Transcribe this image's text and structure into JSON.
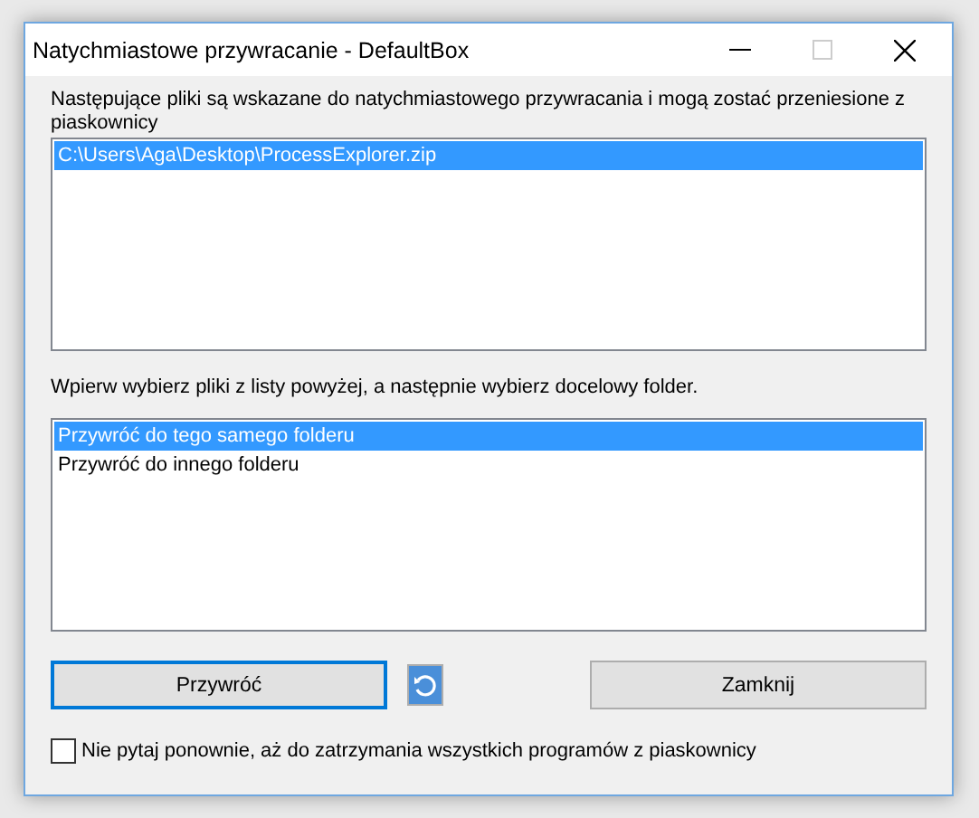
{
  "window": {
    "title": "Natychmiastowe przywracanie - DefaultBox"
  },
  "intro": "Następujące pliki są wskazane do natychmiastowego przywracania i mogą zostać przeniesione z piaskownicy",
  "files": [
    {
      "label": "C:\\Users\\Aga\\Desktop\\ProcessExplorer.zip",
      "selected": true
    }
  ],
  "hint": "Wpierw wybierz pliki z listy powyżej, a następnie wybierz docelowy folder.",
  "targets": [
    {
      "label": "Przywróć do tego samego folderu",
      "selected": true
    },
    {
      "label": "Przywróć do innego folderu",
      "selected": false
    }
  ],
  "buttons": {
    "restore": "Przywróć",
    "close": "Zamknij"
  },
  "dont_ask": {
    "label": "Nie pytaj ponownie, aż do zatrzymania wszystkich programów z piaskownicy",
    "checked": false
  }
}
